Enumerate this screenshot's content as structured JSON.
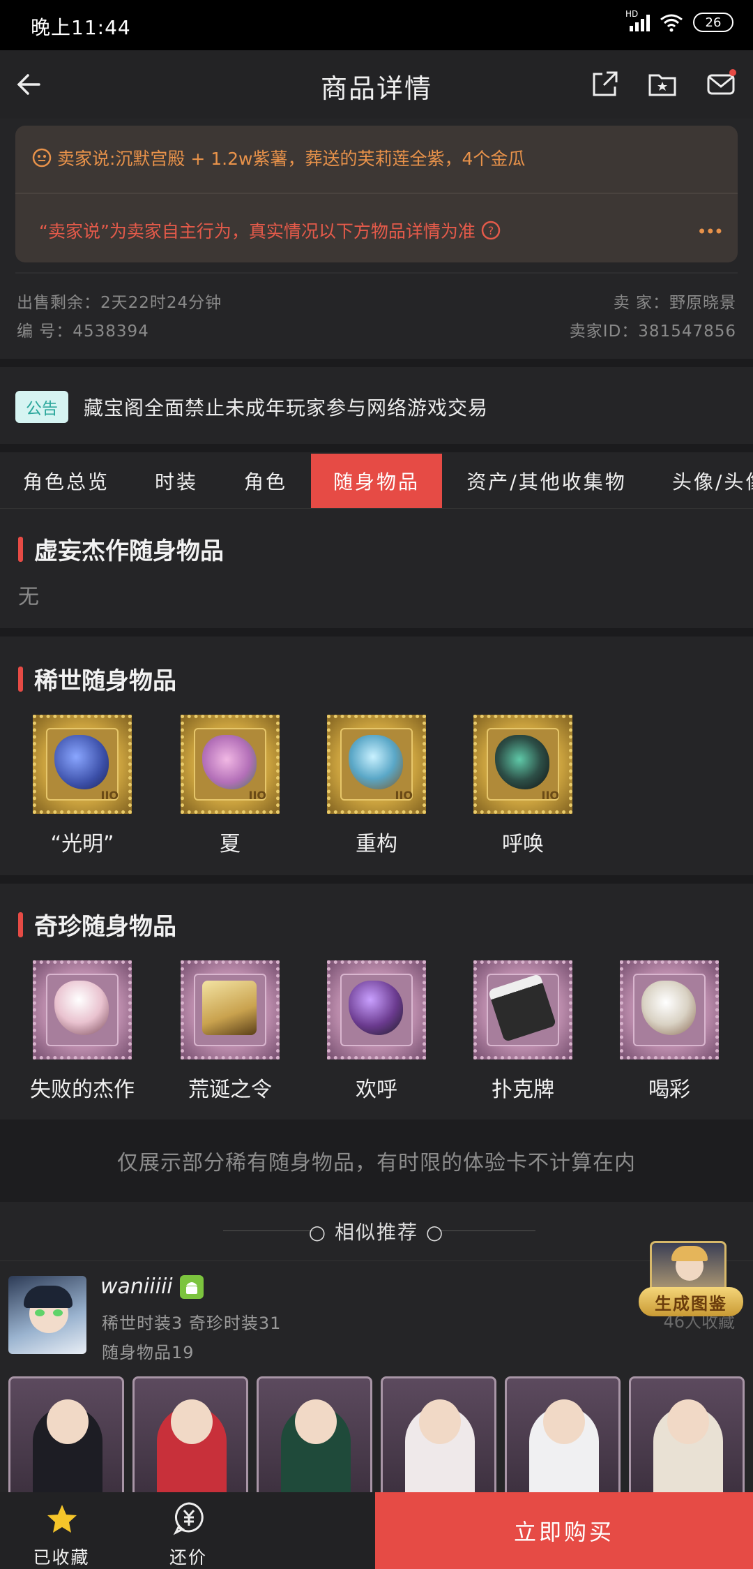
{
  "status": {
    "time": "晚上11:44",
    "network": "HD",
    "battery": "26"
  },
  "nav": {
    "title": "商品详情"
  },
  "seller_note": {
    "text": "卖家说:沉默宫殿 + 1.2w紫薯，葬送的芙莉莲全紫，4个金瓜",
    "disclaimer": "“卖家说”为卖家自主行为，真实情况以下方物品详情为准"
  },
  "listing": {
    "remaining": "出售剩余：2天22时24分钟",
    "serial": "编 号：4538394",
    "seller": "卖 家：野原晓景",
    "seller_id": "卖家ID：381547856"
  },
  "notice": {
    "tag": "公告",
    "text": "藏宝阁全面禁止未成年玩家参与网络游戏交易"
  },
  "tabs": [
    {
      "label": "角色总览",
      "active": false
    },
    {
      "label": "时装",
      "active": false
    },
    {
      "label": "角色",
      "active": false
    },
    {
      "label": "随身物品",
      "active": true
    },
    {
      "label": "资产/其他收集物",
      "active": false
    },
    {
      "label": "头像/头像",
      "active": false
    }
  ],
  "sections": {
    "masterpiece": {
      "title": "虚妄杰作随身物品",
      "empty": "无"
    },
    "rare": {
      "title": "稀世随身物品",
      "items": [
        {
          "label": "“光明”",
          "color": "#3b4fa8"
        },
        {
          "label": "夏",
          "color": "#b36fb8"
        },
        {
          "label": "重构",
          "color": "#5aa7c7"
        },
        {
          "label": "呼唤",
          "color": "#2d4f47"
        }
      ]
    },
    "precious": {
      "title": "奇珍随身物品",
      "items": [
        {
          "label": "失败的杰作",
          "color": "#e9c2cf"
        },
        {
          "label": "荒诞之令",
          "color": "#c9a24e"
        },
        {
          "label": "欢呼",
          "color": "#6a3a8e"
        },
        {
          "label": "扑克牌",
          "color": "#2b2b2b"
        },
        {
          "label": "喝彩",
          "color": "#d9d2c4"
        }
      ]
    }
  },
  "footer_note": "仅展示部分稀有随身物品，有时限的体验卡不计算在内",
  "similar": {
    "title": "相似推荐",
    "user": {
      "name": "waniiiii",
      "line1": "稀世时装3 奇珍时装31",
      "line2": "随身物品19",
      "fav": "46人收藏"
    },
    "gen_badge": "生成图鉴",
    "skins": [
      {
        "body": "#1d1d24"
      },
      {
        "body": "#c8303a"
      },
      {
        "body": "#1f4a3a"
      },
      {
        "body": "#efe9ea"
      },
      {
        "body": "#f0f0f2"
      },
      {
        "body": "#e9e1d4"
      }
    ]
  },
  "bottom": {
    "fav_label": "已收藏",
    "bargain_label": "还价",
    "buy_label": "立即购买"
  },
  "colors": {
    "accent": "#e64b45",
    "bg": "#252527",
    "note": "#e8924a"
  }
}
